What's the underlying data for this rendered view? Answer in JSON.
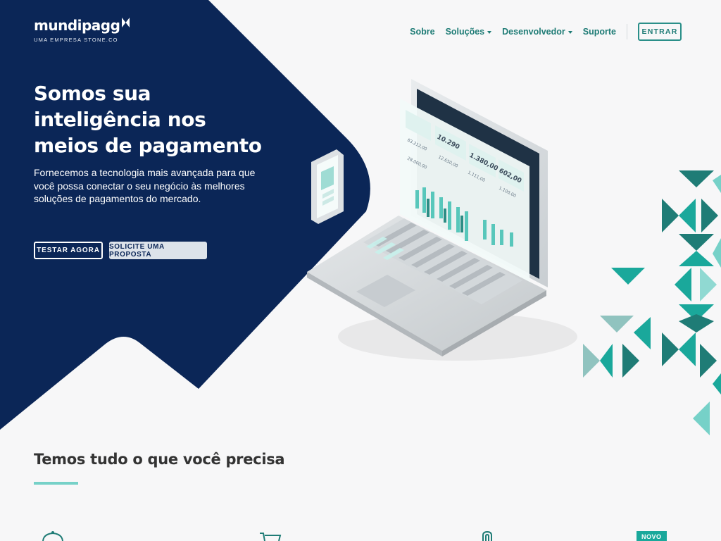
{
  "brand": {
    "name": "mundipagg",
    "tagline": "UMA EMPRESA STONE.CO"
  },
  "nav": {
    "items": [
      {
        "label": "Sobre",
        "dropdown": false
      },
      {
        "label": "Soluções",
        "dropdown": true
      },
      {
        "label": "Desenvolvedor",
        "dropdown": true
      },
      {
        "label": "Suporte",
        "dropdown": false
      }
    ],
    "login_label": "ENTRAR"
  },
  "hero": {
    "title": "Somos sua inteligência nos meios de pagamento",
    "subtitle": "Fornecemos a tecnologia mais avançada para que você possa conectar o seu negócio às melhores soluções de pagamentos do mercado.",
    "primary_cta": "TESTAR AGORA",
    "secondary_cta": "SOLICITE UMA PROPOSTA"
  },
  "dashboard_values": [
    "10.290",
    "1.380,00",
    "602,00",
    "83.212,00",
    "12.650,00",
    "1.111,00",
    "1.100,00",
    "28.000,00"
  ],
  "features": {
    "title": "Temos tudo o que você precisa",
    "icons": [
      "tag-icon",
      "cart-icon",
      "attachment-icon"
    ],
    "badge": "NOVO"
  },
  "colors": {
    "navy": "#0b2657",
    "teal_dark": "#1f7c76",
    "teal": "#1aa89b",
    "teal_light": "#76d1c8",
    "background": "#f7f7f8"
  }
}
